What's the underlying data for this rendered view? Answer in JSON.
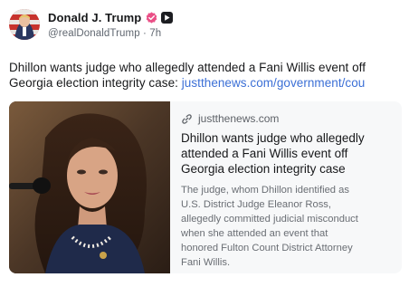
{
  "author": {
    "display_name": "Donald J. Trump",
    "handle": "@realDonaldTrump · 7h",
    "verified_icon": "verified-badge-icon",
    "app_icon": "app-badge-icon",
    "avatar_icon": "avatar"
  },
  "post": {
    "text_line1": "Dhillon wants judge who allegedly attended a Fani Willis event off",
    "text_line2_prefix": "Georgia election integrity case: ",
    "text_link": "justthenews.com/government/cou"
  },
  "link_card": {
    "domain": "justthenews.com",
    "title_lines": [
      "Dhillon wants judge who allegedly",
      "attended a Fani Willis event off",
      "Georgia election integrity case"
    ],
    "description_lines": [
      "The judge, whom Dhillon identified as",
      "U.S. District Judge Eleanor Ross,",
      "allegedly committed judicial misconduct",
      "when she attended an event that",
      "honored Fulton Count District Attorney",
      "Fani Willis."
    ]
  },
  "colors": {
    "link": "#3b6fd6",
    "verified": "#ea4f86",
    "muted_text": "#606770"
  }
}
